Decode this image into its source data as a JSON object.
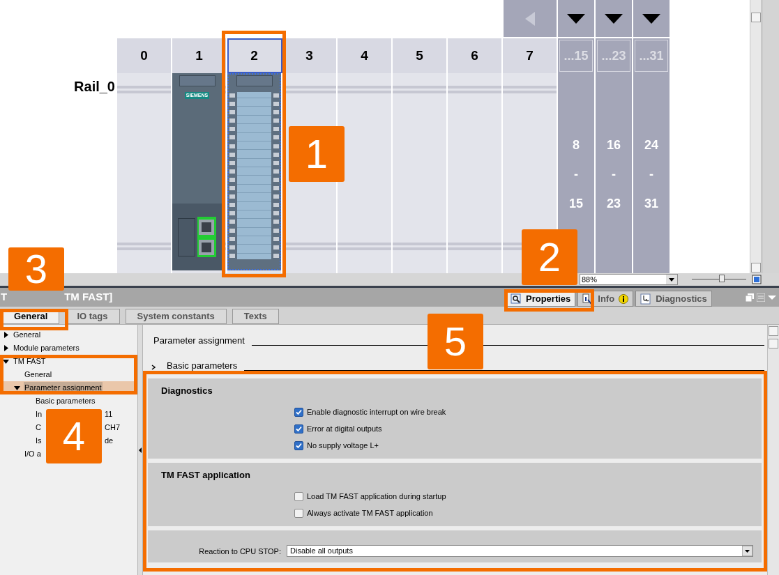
{
  "rack": {
    "rail_label": "Rail_0",
    "slots": [
      {
        "label": "0",
        "selected": false
      },
      {
        "label": "1",
        "selected": false,
        "module": {
          "kind": "cpu",
          "brand": "SIEMENS"
        }
      },
      {
        "label": "2",
        "selected": true,
        "module": {
          "kind": "tm"
        }
      },
      {
        "label": "3",
        "selected": false
      },
      {
        "label": "4",
        "selected": false
      },
      {
        "label": "5",
        "selected": false
      },
      {
        "label": "6",
        "selected": false
      },
      {
        "label": "7",
        "selected": false
      }
    ],
    "expansion": [
      {
        "header": "...15",
        "range_start": "8",
        "dash": "-",
        "range_end": "15"
      },
      {
        "header": "...23",
        "range_start": "16",
        "dash": "-",
        "range_end": "23"
      },
      {
        "header": "...31",
        "range_start": "24",
        "dash": "-",
        "range_end": "31"
      }
    ]
  },
  "zoom": {
    "value": "88%",
    "level": 0.55
  },
  "inspector": {
    "title_start": "T",
    "title_end": "TM FAST]",
    "tabs": [
      {
        "label": "Properties",
        "kind": "properties",
        "selected": true
      },
      {
        "label": "Info",
        "kind": "info",
        "selected": false
      },
      {
        "label": "Diagnostics",
        "kind": "diagnostics",
        "selected": false
      }
    ],
    "subtabs": [
      {
        "label": "General",
        "selected": true
      },
      {
        "label": "IO tags",
        "selected": false
      },
      {
        "label": "System constants",
        "selected": false
      },
      {
        "label": "Texts",
        "selected": false
      }
    ],
    "tree": [
      {
        "label": "General",
        "expanded": false,
        "selected": false
      },
      {
        "label": "Module parameters",
        "expanded": false,
        "selected": false
      },
      {
        "label": "TM FAST",
        "expanded": true,
        "selected": false,
        "children": [
          {
            "label": "General",
            "selected": false
          },
          {
            "label": "Parameter assignment",
            "expanded": true,
            "selected": true,
            "children": [
              {
                "label": "Basic parameters",
                "selected": false
              },
              {
                "label": "In",
                "label_tail": "11",
                "selected": false
              },
              {
                "label": "C",
                "label_tail": "CH7",
                "selected": false
              },
              {
                "label": "Is",
                "label_tail": "de",
                "selected": false
              }
            ]
          },
          {
            "label": "I/O a",
            "selected": false
          }
        ]
      }
    ],
    "content": {
      "heading": "Parameter assignment",
      "subheading": "Basic parameters",
      "sections": [
        {
          "title": "Diagnostics",
          "options": [
            {
              "label": "Enable diagnostic interrupt on wire break",
              "checked": true
            },
            {
              "label": "Error at digital outputs",
              "checked": true
            },
            {
              "label": "No supply voltage L+",
              "checked": true
            }
          ]
        },
        {
          "title": "TM FAST application",
          "options": [
            {
              "label": "Load TM FAST application during startup",
              "checked": false
            },
            {
              "label": "Always activate TM FAST application",
              "checked": false
            }
          ]
        }
      ],
      "reaction": {
        "label": "Reaction to CPU STOP:",
        "value": "Disable all outputs"
      }
    }
  },
  "callouts": [
    {
      "number": "1"
    },
    {
      "number": "2"
    },
    {
      "number": "3"
    },
    {
      "number": "4"
    },
    {
      "number": "5"
    }
  ]
}
